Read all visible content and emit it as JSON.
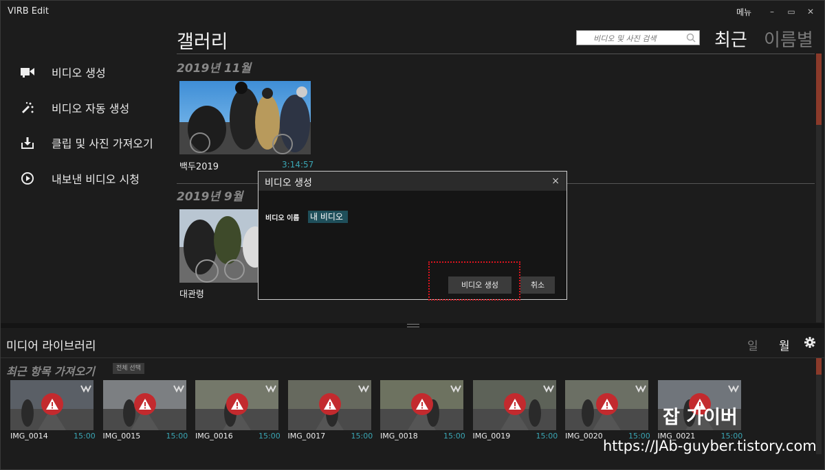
{
  "window": {
    "title": "VIRB Edit",
    "menu_label": "메뉴",
    "minimize": "–",
    "maximize": "▭",
    "close": "✕"
  },
  "sidebar": {
    "items": [
      {
        "label": "비디오 생성",
        "icon": "video-camera-icon"
      },
      {
        "label": "비디오 자동 생성",
        "icon": "magic-wand-icon"
      },
      {
        "label": "클립 및 사진 가져오기",
        "icon": "download-icon"
      },
      {
        "label": "내보낸 비디오 시청",
        "icon": "play-circle-icon"
      }
    ]
  },
  "gallery": {
    "title": "갤러리",
    "search_placeholder": "비디오 및 사진 검색",
    "sort_recent": "최근",
    "sort_name": "이름별",
    "sections": [
      {
        "date": "2019년 11월",
        "videos": [
          {
            "name": "백두2019",
            "duration": "3:14:57"
          }
        ]
      },
      {
        "date": "2019년 9월",
        "videos": [
          {
            "name": "대관령",
            "duration": ""
          }
        ]
      }
    ]
  },
  "dialog": {
    "title": "비디오 생성",
    "close": "×",
    "field_label": "비디오 이름",
    "field_value": "내 비디오",
    "create_button": "비디오 생성",
    "cancel_button": "취소"
  },
  "media_library": {
    "title": "미디어 라이브러리",
    "tab_day": "일",
    "tab_month": "월",
    "section_label": "최근 항목 가져오기",
    "select_all": "전체 선택",
    "clips": [
      {
        "name": "IMG_0014",
        "duration": "15:00"
      },
      {
        "name": "IMG_0015",
        "duration": "15:00"
      },
      {
        "name": "IMG_0016",
        "duration": "15:00"
      },
      {
        "name": "IMG_0017",
        "duration": "15:00"
      },
      {
        "name": "IMG_0018",
        "duration": "15:00"
      },
      {
        "name": "IMG_0019",
        "duration": "15:00"
      },
      {
        "name": "IMG_0020",
        "duration": "15:00"
      },
      {
        "name": "IMG_0021",
        "duration": "15:00"
      }
    ]
  },
  "watermark": {
    "line1": "잡 가이버",
    "line2": "https://JAb-guyber.tistory.com"
  },
  "colors": {
    "accent": "#3aa6b4",
    "warning": "#c32a2e",
    "highlight": "#e0141e"
  }
}
